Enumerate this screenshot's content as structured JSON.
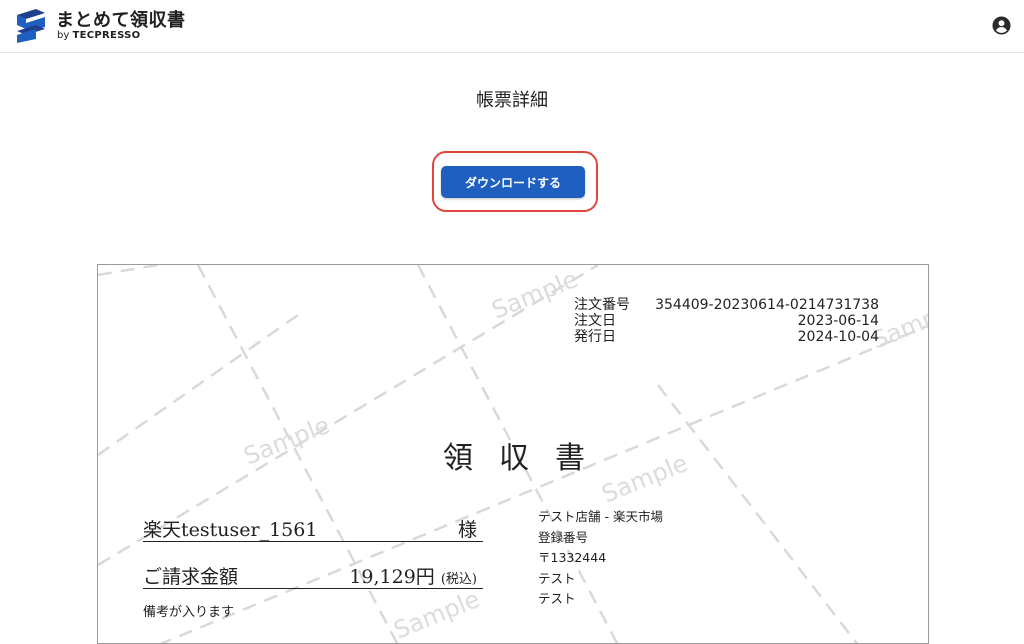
{
  "header": {
    "app_title": "まとめて領収書",
    "by_label": "by",
    "brand": "TECPRESSO",
    "account_icon": "account-circle-icon",
    "logo_icon": "s-shape-logo-icon",
    "brand_color": "#1f5fbf"
  },
  "page": {
    "title": "帳票詳細"
  },
  "download": {
    "label": "ダウンロードする",
    "button_color": "#1f5fbf",
    "highlight_color": "#e0463c"
  },
  "receipt": {
    "watermark_text": "Sample",
    "order_number_label": "注文番号",
    "order_number": "354409-20230614-0214731738",
    "order_date_label": "注文日",
    "order_date": "2023-06-14",
    "issue_date_label": "発行日",
    "issue_date": "2024-10-04",
    "title": "領収書",
    "customer_name": "楽天testuser_1561",
    "honorific": "様",
    "amount_label": "ご請求金額",
    "amount": "19,129円",
    "tax_note": "(税込)",
    "remarks": "備考が入ります",
    "store": {
      "name": "テスト店舗 - 楽天市場",
      "registration_label": "登録番号",
      "postal": "〒1332444",
      "address_line1": "テスト",
      "address_line2": "テスト"
    }
  }
}
